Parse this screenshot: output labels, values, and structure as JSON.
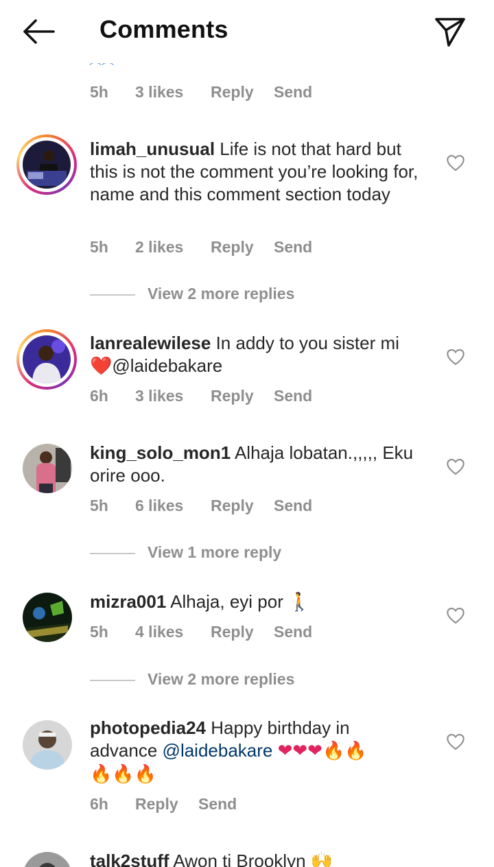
{
  "header": {
    "title": "Comments",
    "back_icon": "arrow-left-icon",
    "share_icon": "paper-plane-icon"
  },
  "partial_top": {
    "time": "5h",
    "likes": "3 likes",
    "reply": "Reply",
    "send": "Send"
  },
  "comments": [
    {
      "username": "limah_unusual",
      "text": "Life is not that hard but this is not the comment you’re looking for, name and this comment section today",
      "time": "5h",
      "likes": "2 likes",
      "reply": "Reply",
      "send": "Send",
      "view_more": "View 2 more replies"
    },
    {
      "username": "lanrealewilese",
      "text": "In addy to you sister mi",
      "emoji": "❤️",
      "mention": "@laidebakare",
      "time": "6h",
      "likes": "3 likes",
      "reply": "Reply",
      "send": "Send"
    },
    {
      "username": "king_solo_mon1",
      "text": "Alhaja lobatan.,,,,, Eku orire ooo.",
      "time": "5h",
      "likes": "6 likes",
      "reply": "Reply",
      "send": "Send",
      "view_more": "View 1 more reply"
    },
    {
      "username": "mizra001",
      "text": "Alhaja, eyi por",
      "emoji": "🚶",
      "time": "5h",
      "likes": "4 likes",
      "reply": "Reply",
      "send": "Send",
      "view_more": "View 2 more replies"
    },
    {
      "username": "photopedia24",
      "text": "Happy birthday in advance",
      "mention": "@laidebakare",
      "hearts": "❤❤❤",
      "fires1": "🔥🔥",
      "fires2": "🔥🔥🔥",
      "time": "6h",
      "reply": "Reply",
      "send": "Send"
    },
    {
      "username": "talk2stuff",
      "text": "Awon ti Brooklyn",
      "emoji": "🙌"
    }
  ],
  "colors": {
    "text": "#262626",
    "meta": "#8e8e8e",
    "mention": "#00376b",
    "divider": "#c7c7c7"
  }
}
